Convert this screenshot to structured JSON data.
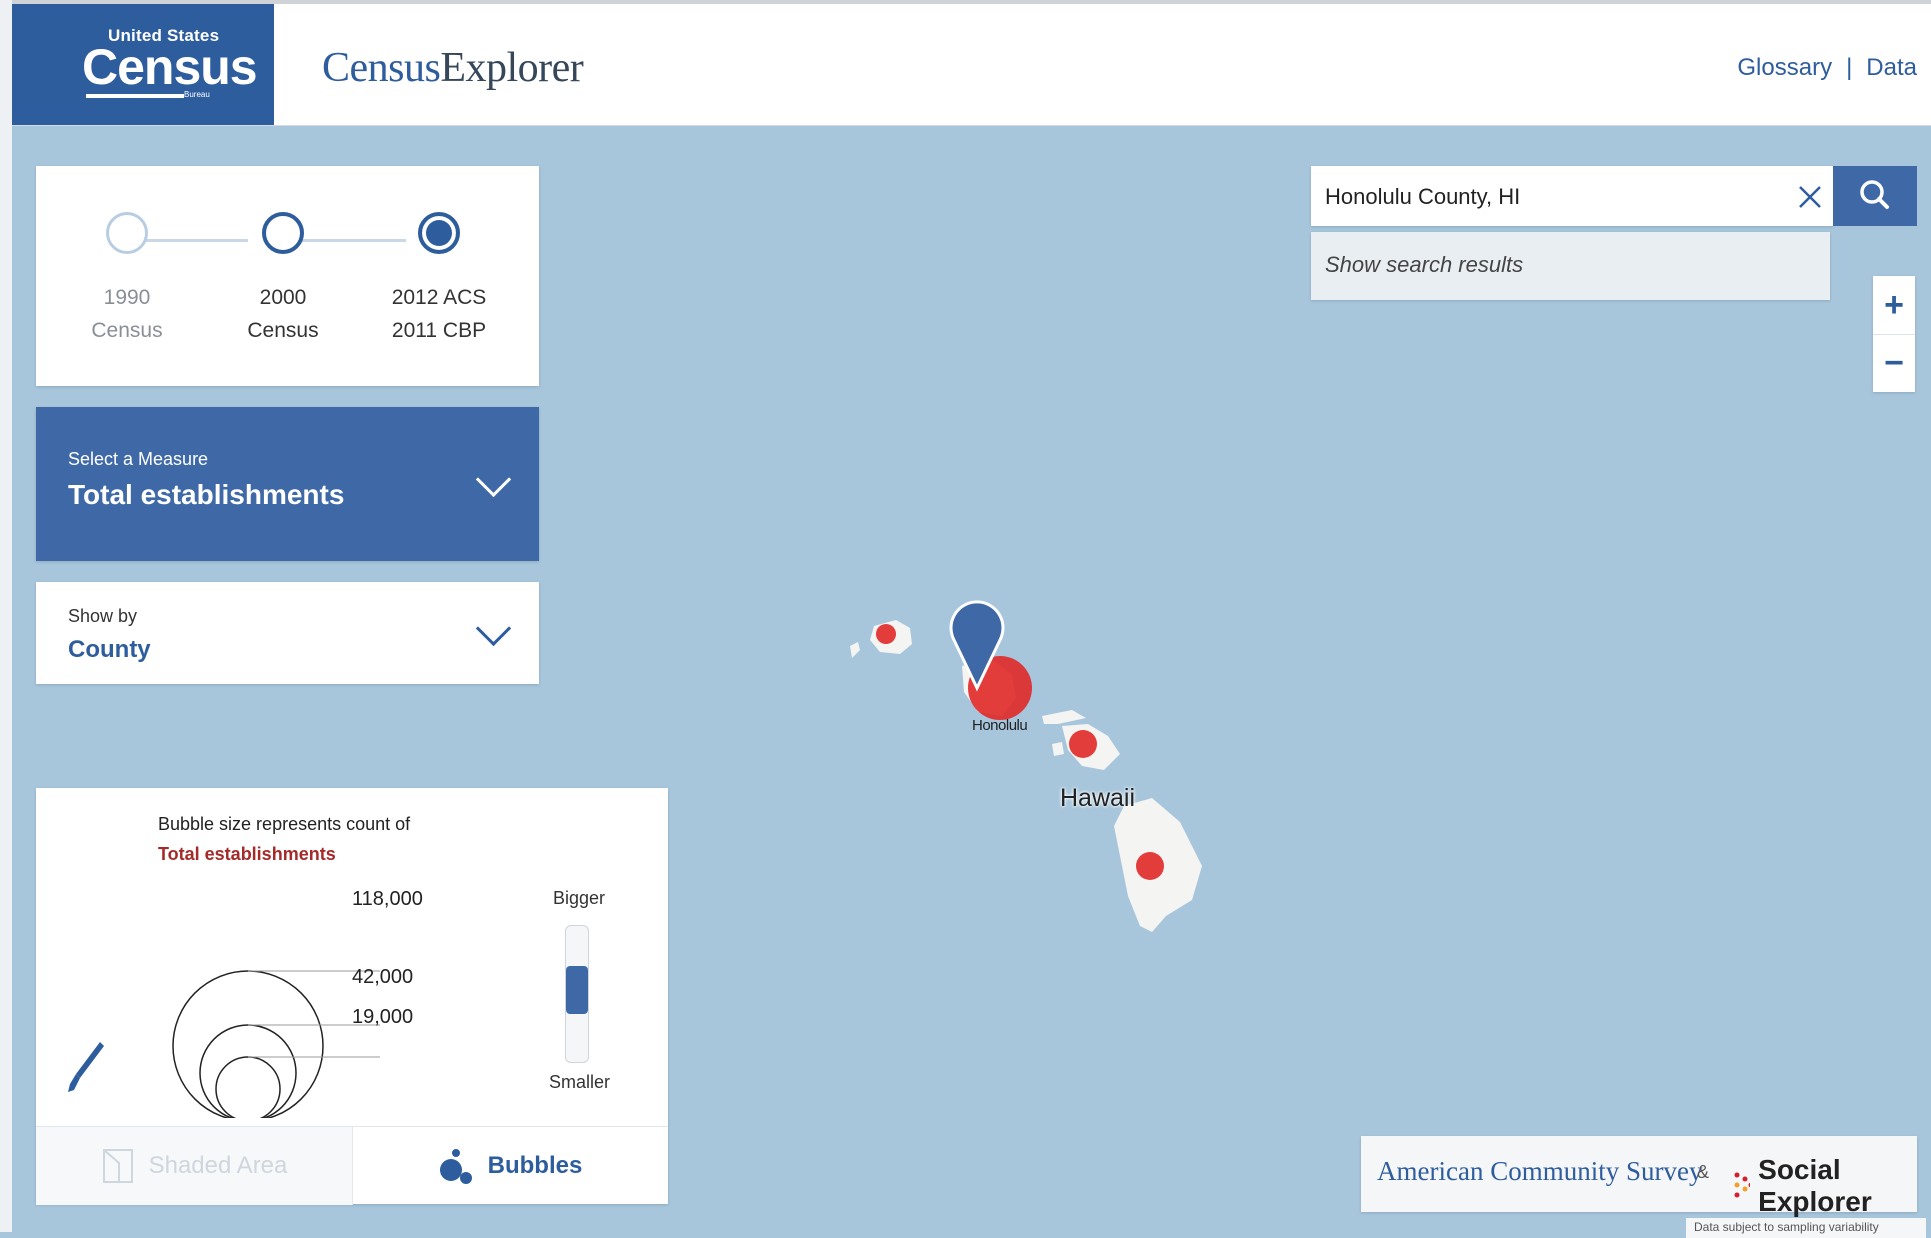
{
  "header": {
    "logo_top": "United States",
    "logo_main": "Census",
    "logo_sub": "Bureau",
    "title_part1": "Census",
    "title_part2": "Explorer",
    "nav": {
      "glossary": "Glossary",
      "separator": "|",
      "data": "Data"
    }
  },
  "timeline": {
    "items": [
      {
        "line1": "1990",
        "line2": "Census",
        "state": "disabled"
      },
      {
        "line1": "2000",
        "line2": "Census",
        "state": "available"
      },
      {
        "line1": "2012 ACS",
        "line2": "2011 CBP",
        "state": "selected"
      }
    ]
  },
  "measure": {
    "caption": "Select a Measure",
    "value": "Total establishments"
  },
  "show_by": {
    "caption": "Show by",
    "value": "County"
  },
  "legend": {
    "caption_line1": "Bubble size represents count of",
    "caption_line2": "Total establishments",
    "values": [
      "118,000",
      "42,000",
      "19,000"
    ],
    "slider_top": "Bigger",
    "slider_bottom": "Smaller",
    "slider_level": 0.45,
    "tabs": {
      "shaded": "Shaded Area",
      "bubbles": "Bubbles"
    }
  },
  "search": {
    "value": "Honolulu County, HI",
    "placeholder": "",
    "results_label": "Show search results"
  },
  "zoom": {
    "in": "+",
    "out": "−"
  },
  "map": {
    "city_label": "Honolulu",
    "region_label": "Hawaii"
  },
  "attribution": {
    "acs": "American Community Survey",
    "amp": "&",
    "social_explorer": "Social Explorer",
    "note": "Data subject to sampling variability"
  },
  "colors": {
    "brand": "#2e5d9e",
    "accent_red": "#a52a2a",
    "bubble_red": "#e02b2b",
    "water": "#a7c6dc"
  },
  "icons": [
    "search-icon",
    "close-icon",
    "chevron-down-icon",
    "paintbrush-icon",
    "shaded-area-icon",
    "bubbles-icon",
    "map-pin-icon"
  ]
}
